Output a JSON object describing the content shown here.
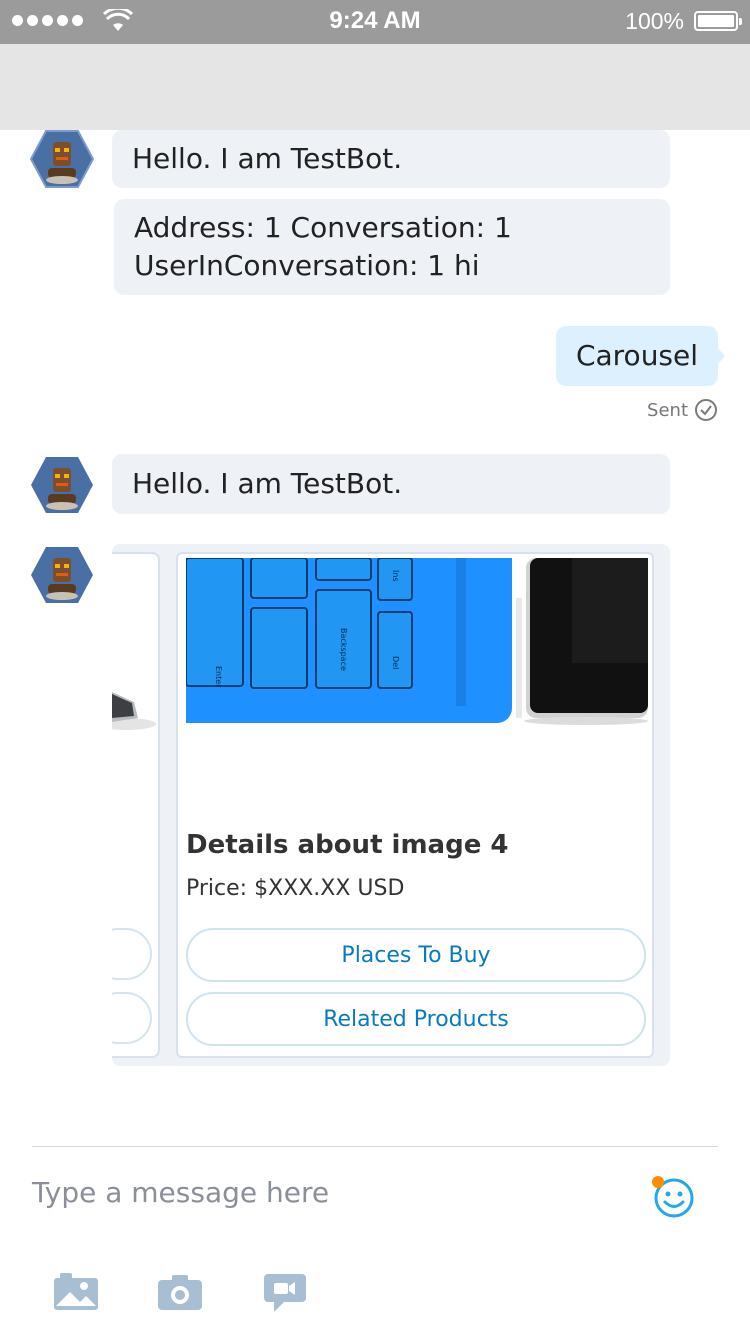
{
  "status_bar": {
    "time": "9:24 AM",
    "battery": "100%"
  },
  "messages": {
    "bot_greeting_1": "Hello. I am TestBot.",
    "bot_info_line1": "Address: 1 Conversation: 1",
    "bot_info_line2": "UserInConversation: 1 hi",
    "user_message": "Carousel",
    "sent_status": "Sent",
    "bot_greeting_2": "Hello. I am TestBot."
  },
  "carousel": {
    "card": {
      "title": "Details about image 4",
      "subtitle": "Price: $XXX.XX USD",
      "buttons": [
        "Places To Buy",
        "Related Products"
      ],
      "keys": [
        "Enter",
        "Backspace",
        "Del",
        "Ins"
      ]
    }
  },
  "compose": {
    "placeholder": "Type a message here",
    "tools": [
      "gallery-icon",
      "camera-icon",
      "video-message-icon"
    ]
  },
  "colors": {
    "status_bar": "#9b9b9b",
    "bot_bubble": "#eef1f6",
    "user_bubble": "#dcf0fd",
    "accent": "#0a7abf",
    "keyboard_blue": "#1e90ff"
  }
}
